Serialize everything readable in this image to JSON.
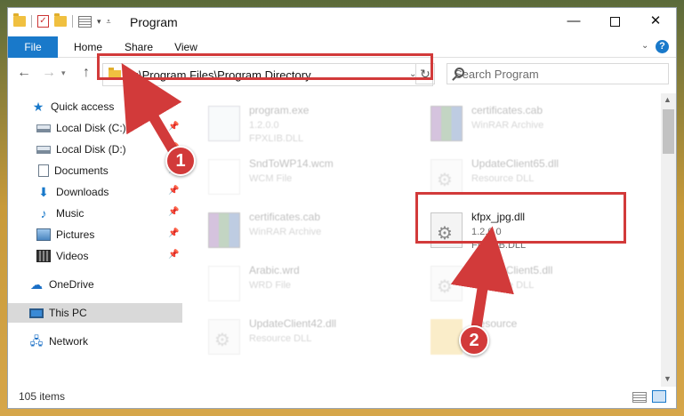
{
  "window": {
    "title": "Program",
    "minimize": "—",
    "maximize": "",
    "close": "✕"
  },
  "ribbon": {
    "tabs": [
      "File",
      "Home",
      "Share",
      "View"
    ],
    "help": "?"
  },
  "nav": {
    "back": "←",
    "forward": "→",
    "recent": "▾",
    "up": "↑",
    "address": "C:\\Program Files\\Program Directory",
    "address_chevron": "⌄",
    "refresh": "↻",
    "search_placeholder": "Search Program"
  },
  "sidebar": {
    "items": [
      {
        "label": "Quick access",
        "icon": "star-icon",
        "pinned": false
      },
      {
        "label": "Local Disk (C:)",
        "icon": "drive-icon",
        "pinned": true
      },
      {
        "label": "Local Disk (D:)",
        "icon": "drive-icon",
        "pinned": true
      },
      {
        "label": "Documents",
        "icon": "documents-icon",
        "pinned": true
      },
      {
        "label": "Downloads",
        "icon": "download-icon",
        "pinned": true
      },
      {
        "label": "Music",
        "icon": "music-icon",
        "pinned": true
      },
      {
        "label": "Pictures",
        "icon": "pictures-icon",
        "pinned": true
      },
      {
        "label": "Videos",
        "icon": "videos-icon",
        "pinned": true
      },
      {
        "label": "OneDrive",
        "icon": "cloud-icon",
        "pinned": false
      },
      {
        "label": "This PC",
        "icon": "pc-icon",
        "pinned": false,
        "selected": true
      },
      {
        "label": "Network",
        "icon": "network-icon",
        "pinned": false
      }
    ]
  },
  "files": [
    {
      "name": "program.exe",
      "sub1": "1.2.0.0",
      "sub2": "FPXLIB.DLL",
      "icon": "exe-icon",
      "faded": true
    },
    {
      "name": "certificates.cab",
      "sub1": "WinRAR Archive",
      "sub2": "",
      "icon": "rar-icon",
      "faded": true
    },
    {
      "name": "SndToWP14.wcm",
      "sub1": "WCM File",
      "sub2": "",
      "icon": "blank-file-icon",
      "faded": true
    },
    {
      "name": "UpdateClient65.dll",
      "sub1": "Resource DLL",
      "sub2": "",
      "icon": "dll-icon",
      "faded": true
    },
    {
      "name": "certificates.cab",
      "sub1": "WinRAR Archive",
      "sub2": "",
      "icon": "rar-icon",
      "faded": true
    },
    {
      "name": "kfpx_jpg.dll",
      "sub1": "1.2.0.0",
      "sub2": "FPXLIB.DLL",
      "icon": "dll-icon",
      "faded": false
    },
    {
      "name": "Arabic.wrd",
      "sub1": "WRD File",
      "sub2": "",
      "icon": "blank-file-icon",
      "faded": true
    },
    {
      "name": "UpdateClient5.dll",
      "sub1": "Resource DLL",
      "sub2": "",
      "icon": "dll-icon",
      "faded": true
    },
    {
      "name": "UpdateClient42.dll",
      "sub1": "Resource DLL",
      "sub2": "",
      "icon": "dll-icon",
      "faded": true
    },
    {
      "name": "Resource",
      "sub1": "",
      "sub2": "",
      "icon": "folder-icon",
      "faded": true
    }
  ],
  "status": {
    "count": "105 items"
  },
  "callouts": {
    "step1": "1",
    "step2": "2",
    "color": "#d23a3a"
  }
}
